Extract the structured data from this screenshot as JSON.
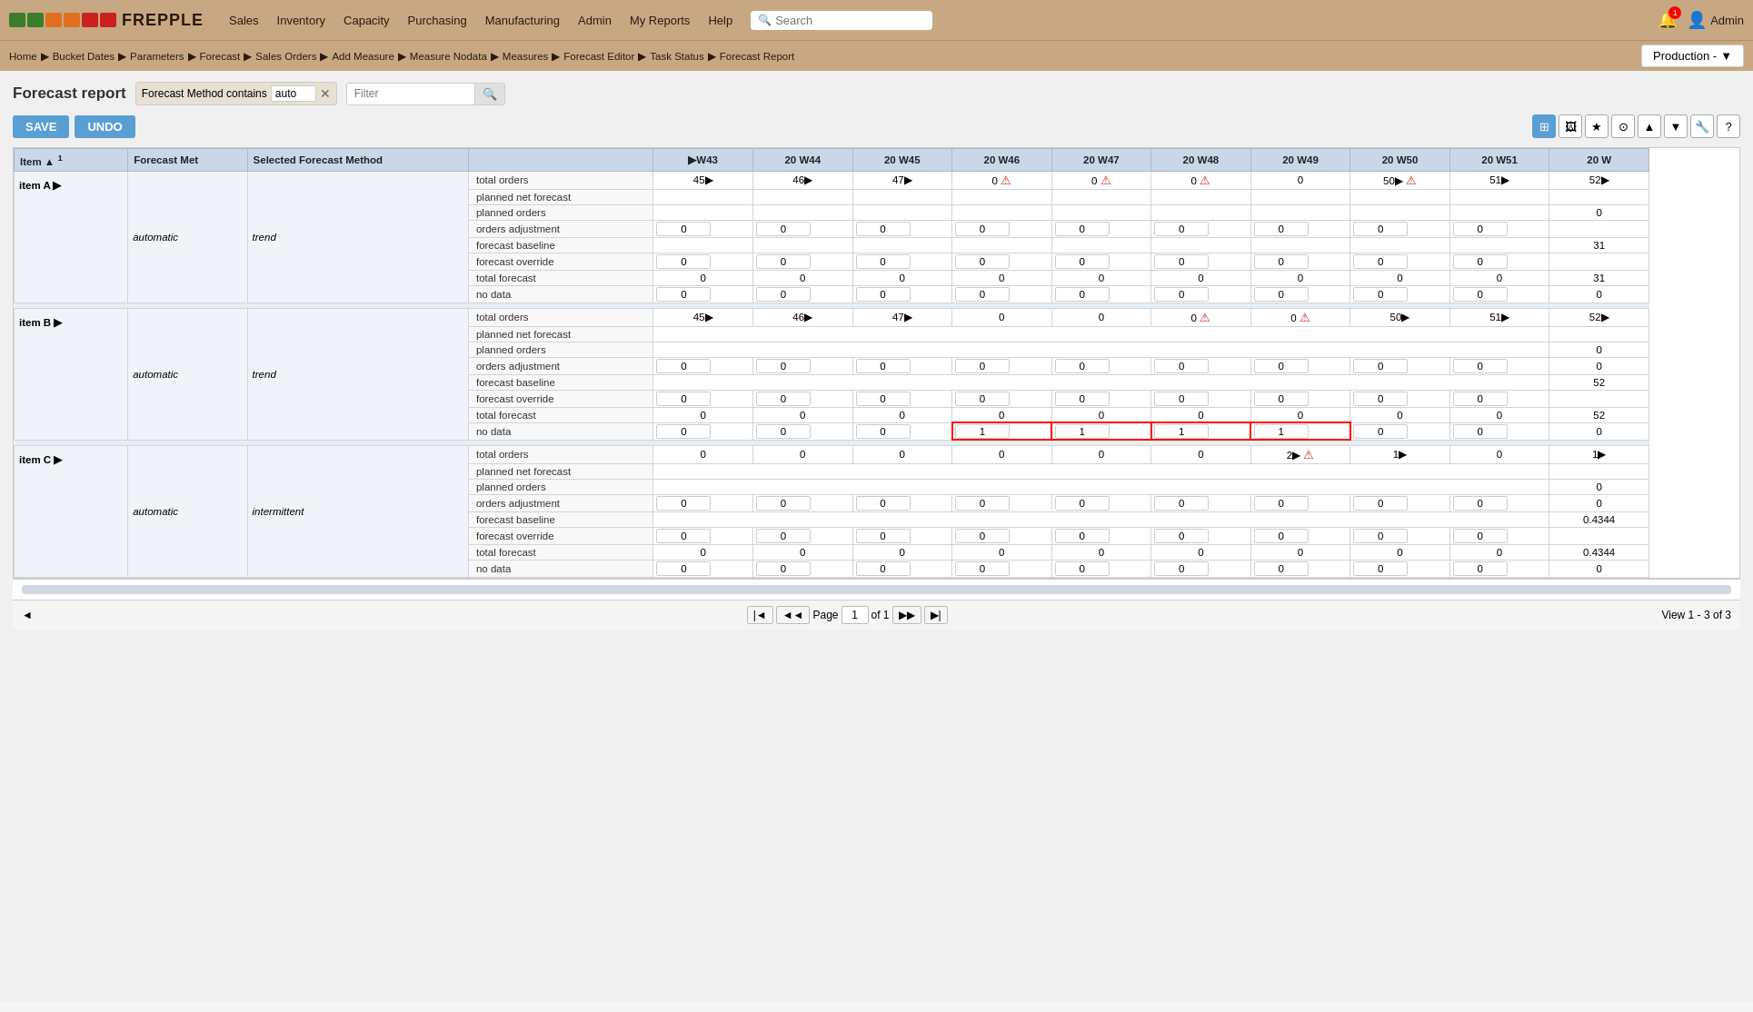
{
  "nav": {
    "logo": "FREPPLE",
    "items": [
      "Sales",
      "Inventory",
      "Capacity",
      "Purchasing",
      "Manufacturing",
      "Admin",
      "My Reports",
      "Help"
    ],
    "search_placeholder": "Search",
    "admin_label": "Admin",
    "notification_count": "1"
  },
  "breadcrumb": {
    "items": [
      "Home",
      "Bucket Dates",
      "Parameters",
      "Forecast",
      "Sales Orders",
      "Add Measure",
      "Measure Nodata",
      "Measures",
      "Forecast Editor",
      "Task Status",
      "Forecast Report"
    ]
  },
  "production": {
    "label": "Production -"
  },
  "report": {
    "title": "Forecast report",
    "filter_label": "Forecast Method contains",
    "filter_value": "auto",
    "filter_placeholder": "Filter",
    "save_label": "SAVE",
    "undo_label": "UNDO"
  },
  "table": {
    "columns": [
      "Item ▲ 1",
      "Forecast Met",
      "Selected Forecast Method",
      "",
      "▶W43",
      "20 W44",
      "20 W45",
      "20 W46",
      "20 W47",
      "20 W48",
      "20 W49",
      "20 W50",
      "20 W51",
      "20 W"
    ],
    "subrows": [
      "total orders",
      "planned net forecast",
      "planned orders",
      "orders adjustment",
      "forecast baseline",
      "forecast override",
      "total forecast",
      "no data"
    ],
    "rows": [
      {
        "item": "item A ▶",
        "method": "automatic",
        "selected": "trend",
        "data": {
          "total_orders": [
            "45▶",
            "46▶",
            "47▶",
            "0⚠",
            "0⚠",
            "0⚠",
            "0",
            "50▶⚠",
            "51▶",
            "52▶"
          ],
          "planned_net": [
            "",
            "",
            "",
            "",
            "",
            "",
            "",
            "",
            "",
            ""
          ],
          "planned_orders": [
            "",
            "",
            "",
            "",
            "",
            "",
            "",
            "",
            "",
            "0"
          ],
          "orders_adj": [
            "0",
            "0",
            "0",
            "0",
            "0",
            "0",
            "0",
            "0",
            "0",
            ""
          ],
          "forecast_base": [
            "",
            "",
            "",
            "",
            "",
            "",
            "",
            "",
            "",
            "31"
          ],
          "forecast_override": [
            "0",
            "0",
            "0",
            "0",
            "0",
            "0",
            "0",
            "0",
            "0",
            ""
          ],
          "total_forecast": [
            "0",
            "0",
            "0",
            "0",
            "0",
            "0",
            "0",
            "0",
            "0",
            "31"
          ],
          "no_data": [
            "0",
            "0",
            "0",
            "0",
            "0",
            "0",
            "0",
            "0",
            "0",
            "0"
          ]
        }
      },
      {
        "item": "item B ▶",
        "method": "automatic",
        "selected": "trend",
        "data": {
          "total_orders": [
            "45▶",
            "46▶",
            "47▶",
            "0",
            "0",
            "0⚠",
            "0⚠",
            "50▶",
            "51▶",
            "52▶"
          ],
          "planned_net": [
            "",
            "",
            "",
            "",
            "",
            "",
            "",
            "",
            "",
            ""
          ],
          "planned_orders": [
            "",
            "",
            "",
            "",
            "",
            "",
            "",
            "",
            "",
            "0"
          ],
          "orders_adj": [
            "0",
            "0",
            "0",
            "0",
            "0",
            "0",
            "0",
            "0",
            "0",
            "0"
          ],
          "forecast_base": [
            "",
            "",
            "",
            "",
            "",
            "",
            "",
            "",
            "",
            "52"
          ],
          "forecast_override": [
            "0",
            "0",
            "0",
            "0",
            "0",
            "0",
            "0",
            "0",
            "0",
            ""
          ],
          "total_forecast": [
            "0",
            "0",
            "0",
            "0",
            "0",
            "0",
            "0",
            "0",
            "0",
            "52"
          ],
          "no_data_highlight": true,
          "no_data": [
            "0",
            "0",
            "0",
            "1",
            "1",
            "1",
            "1",
            "0",
            "0",
            "0"
          ]
        }
      },
      {
        "item": "item C ▶",
        "method": "automatic",
        "selected": "intermittent",
        "data": {
          "total_orders": [
            "0",
            "0",
            "0",
            "0",
            "0",
            "0",
            "2▶⚠",
            "1▶",
            "0",
            "1▶"
          ],
          "planned_net": [
            "",
            "",
            "",
            "",
            "",
            "",
            "",
            "",
            "",
            ""
          ],
          "planned_orders": [
            "",
            "",
            "",
            "",
            "",
            "",
            "",
            "",
            "",
            "0"
          ],
          "orders_adj": [
            "0",
            "0",
            "0",
            "0",
            "0",
            "0",
            "0",
            "0",
            "0",
            "0"
          ],
          "forecast_base": [
            "",
            "",
            "",
            "",
            "",
            "",
            "",
            "",
            "",
            "0.4344"
          ],
          "forecast_override": [
            "0",
            "0",
            "0",
            "0",
            "0",
            "0",
            "0",
            "0",
            "0",
            ""
          ],
          "total_forecast": [
            "0",
            "0",
            "0",
            "0",
            "0",
            "0",
            "0",
            "0",
            "0",
            "0.4344"
          ],
          "no_data": [
            "0",
            "0",
            "0",
            "0",
            "0",
            "0",
            "0",
            "0",
            "0",
            "0"
          ]
        }
      }
    ]
  },
  "pagination": {
    "page_label": "Page",
    "current_page": "1",
    "total_pages": "of 1",
    "view_label": "View 1 - 3 of 3"
  }
}
